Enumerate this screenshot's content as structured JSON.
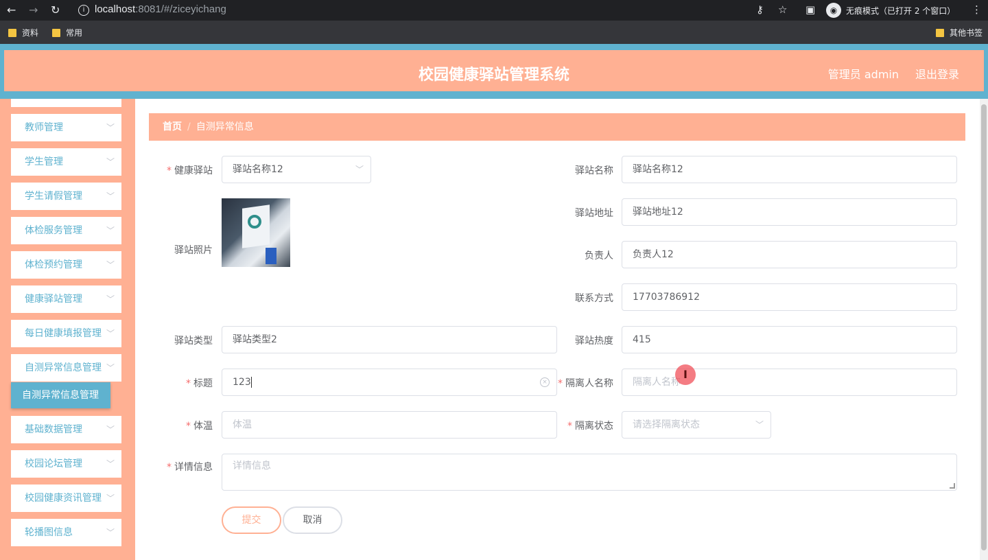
{
  "browser": {
    "url_host": "localhost",
    "url_rest": ":8081/#/ziceyichang",
    "incognito_label": "无痕模式（已打开 2 个窗口）",
    "bookmarks": [
      "资料",
      "常用"
    ],
    "other_bookmarks": "其他书签"
  },
  "header": {
    "title": "校园健康驿站管理系统",
    "user": "管理员 admin",
    "logout": "退出登录"
  },
  "sidebar": {
    "items": [
      "教师管理",
      "学生管理",
      "学生请假管理",
      "体检服务管理",
      "体检预约管理",
      "健康驿站管理",
      "每日健康填报管理",
      "自测异常信息管理",
      "基础数据管理",
      "校园论坛管理",
      "校园健康资讯管理",
      "轮播图信息"
    ],
    "active_sub": "自测异常信息管理"
  },
  "breadcrumb": {
    "home": "首页",
    "current": "自测异常信息"
  },
  "form": {
    "station_label": "健康驿站",
    "station_value": "驿站名称12",
    "photo_label": "驿站照片",
    "type_label": "驿站类型",
    "type_value": "驿站类型2",
    "title_label": "标题",
    "title_value": "123",
    "temp_label": "体温",
    "temp_placeholder": "体温",
    "detail_label": "详情信息",
    "detail_placeholder": "详情信息",
    "name_label": "驿站名称",
    "name_value": "驿站名称12",
    "address_label": "驿站地址",
    "address_value": "驿站地址12",
    "manager_label": "负责人",
    "manager_value": "负责人12",
    "contact_label": "联系方式",
    "contact_value": "17703786912",
    "heat_label": "驿站热度",
    "heat_value": "415",
    "isolation_name_label": "隔离人名称",
    "isolation_name_placeholder": "隔离人名称",
    "isolation_status_label": "隔离状态",
    "isolation_status_placeholder": "请选择隔离状态",
    "submit": "提交",
    "cancel": "取消"
  },
  "colors": {
    "header": "#ffb093",
    "accent": "#5fb2cf"
  }
}
